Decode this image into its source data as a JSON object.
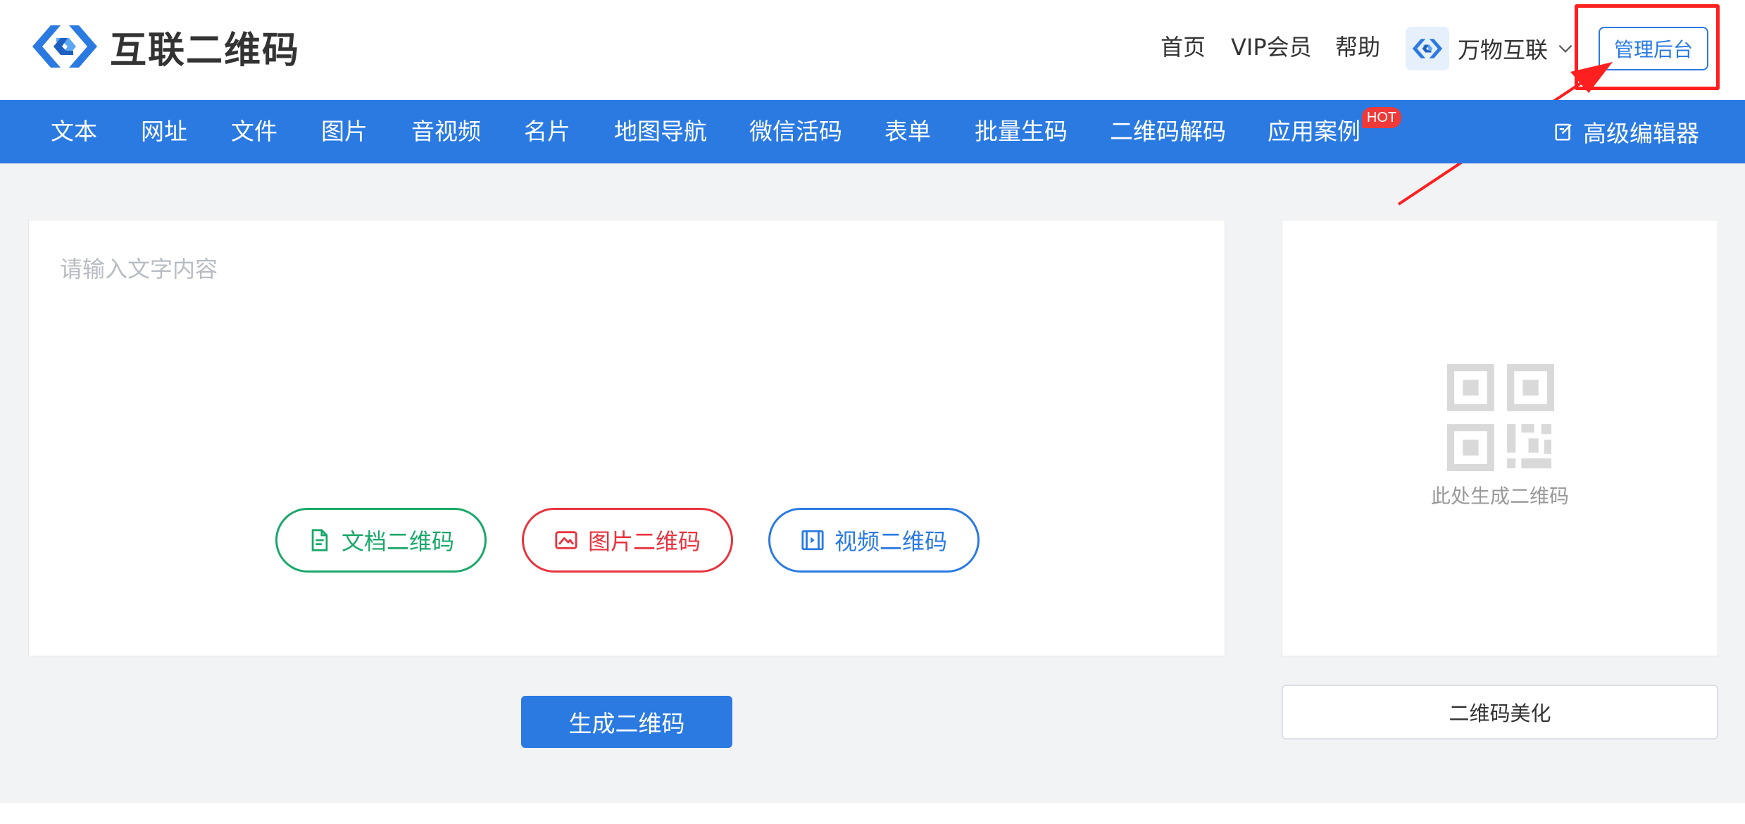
{
  "header": {
    "logo_text": "互联二维码",
    "top_links": [
      {
        "label": "首页"
      },
      {
        "label": "VIP会员"
      },
      {
        "label": "帮助"
      }
    ],
    "brand_switch_label": "万物互联",
    "admin_button_label": "管理后台"
  },
  "navbar": {
    "items": [
      {
        "label": "文本"
      },
      {
        "label": "网址"
      },
      {
        "label": "文件"
      },
      {
        "label": "图片"
      },
      {
        "label": "音视频"
      },
      {
        "label": "名片"
      },
      {
        "label": "地图导航"
      },
      {
        "label": "微信活码"
      },
      {
        "label": "表单"
      },
      {
        "label": "批量生码"
      },
      {
        "label": "二维码解码"
      },
      {
        "label": "应用案例"
      }
    ],
    "hot_badge": "HOT",
    "advanced_editor_label": "高级编辑器"
  },
  "editor": {
    "placeholder": "请输入文字内容",
    "value": "",
    "pills": {
      "doc": "文档二维码",
      "img": "图片二维码",
      "vid": "视频二维码"
    },
    "generate_label": "生成二维码"
  },
  "preview": {
    "placeholder_text": "此处生成二维码",
    "beautify_label": "二维码美化"
  },
  "colors": {
    "primary": "#2a7ae2",
    "doc_green": "#1aa86a",
    "img_red": "#e8343f",
    "annotation_red": "#ff1f1f",
    "hot_red": "#f03a3a"
  },
  "icons": {
    "logo": "link-chain-logo-icon",
    "brand_switch": "link-chain-logo-icon",
    "chevron": "chevron-down-icon",
    "advanced_editor": "edit-icon",
    "doc_pill": "document-icon",
    "img_pill": "image-icon",
    "vid_pill": "video-icon",
    "preview": "qr-code-icon"
  }
}
